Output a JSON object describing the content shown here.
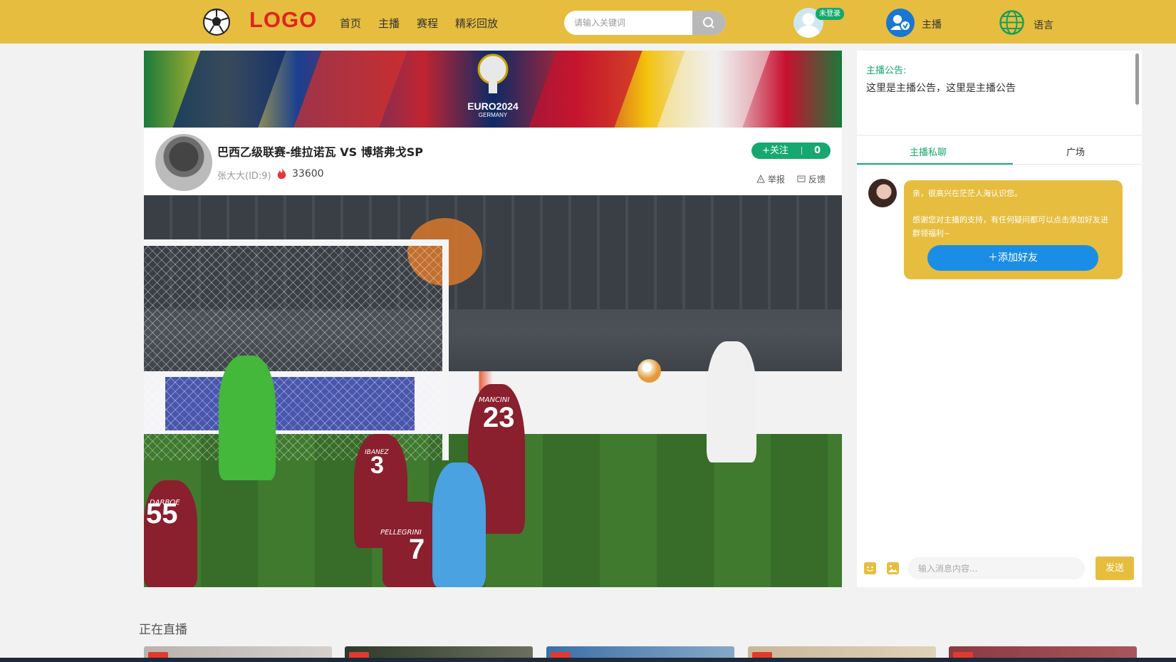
{
  "header": {
    "logo": "LOGO",
    "nav": [
      "首页",
      "主播",
      "赛程",
      "精彩回放"
    ],
    "search": {
      "placeholder": "请输入关键词"
    },
    "login_badge": "未登录",
    "anchor_label": "主播",
    "lang_label": "语言"
  },
  "banner": {
    "title": "EURO2024",
    "subtitle": "GERMANY"
  },
  "stream": {
    "title": "巴西乙级联赛-维拉诺瓦 VS 博塔弗戈SP",
    "streamer": "张大大(ID:9)",
    "popularity": "33600",
    "follow_label": "+关注",
    "follow_count": "0",
    "report_label": "举报",
    "feedback_label": "反馈"
  },
  "video": {
    "jersey_numbers": [
      "23",
      "3",
      "7",
      "55"
    ],
    "jersey_names": [
      "MANCINI",
      "IBANEZ",
      "PELLEGRINI",
      "DARBOE"
    ]
  },
  "notice": {
    "label": "主播公告:",
    "text": "这里是主播公告，这里是主播公告"
  },
  "chat": {
    "tabs": [
      "主播私聊",
      "广场"
    ],
    "greeting": "亲，很高兴在茫茫人海认识您。",
    "message": "感谢您对主播的支持，有任何疑问都可以点击添加好友进群领福利~",
    "add_friend": "＋添加好友",
    "input_placeholder": "输入消息内容...",
    "send_label": "发送"
  },
  "live": {
    "heading": "正在直播"
  },
  "colors": {
    "header": "#e6bd3e",
    "accent_green": "#16a86e",
    "logo_red": "#e0231d",
    "button_blue": "#1a8ee6"
  }
}
